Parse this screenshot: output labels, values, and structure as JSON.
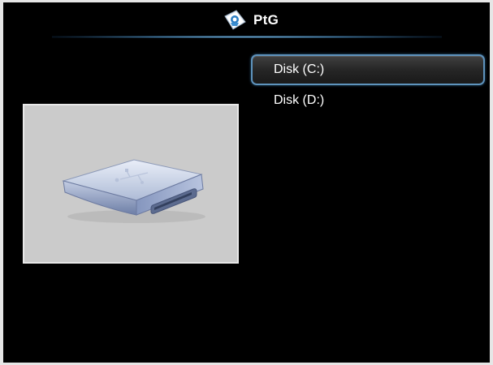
{
  "header": {
    "title": "PtG",
    "icon": "ptg-app-icon"
  },
  "preview": {
    "icon": "usb-drive-icon"
  },
  "drives": [
    {
      "label": "Disk (C:)",
      "selected": true
    },
    {
      "label": "Disk (D:)",
      "selected": false
    }
  ],
  "colors": {
    "background": "#000000",
    "selection_border": "#5e93bd",
    "preview_panel": "#cbcbcb",
    "text": "#ffffff"
  }
}
